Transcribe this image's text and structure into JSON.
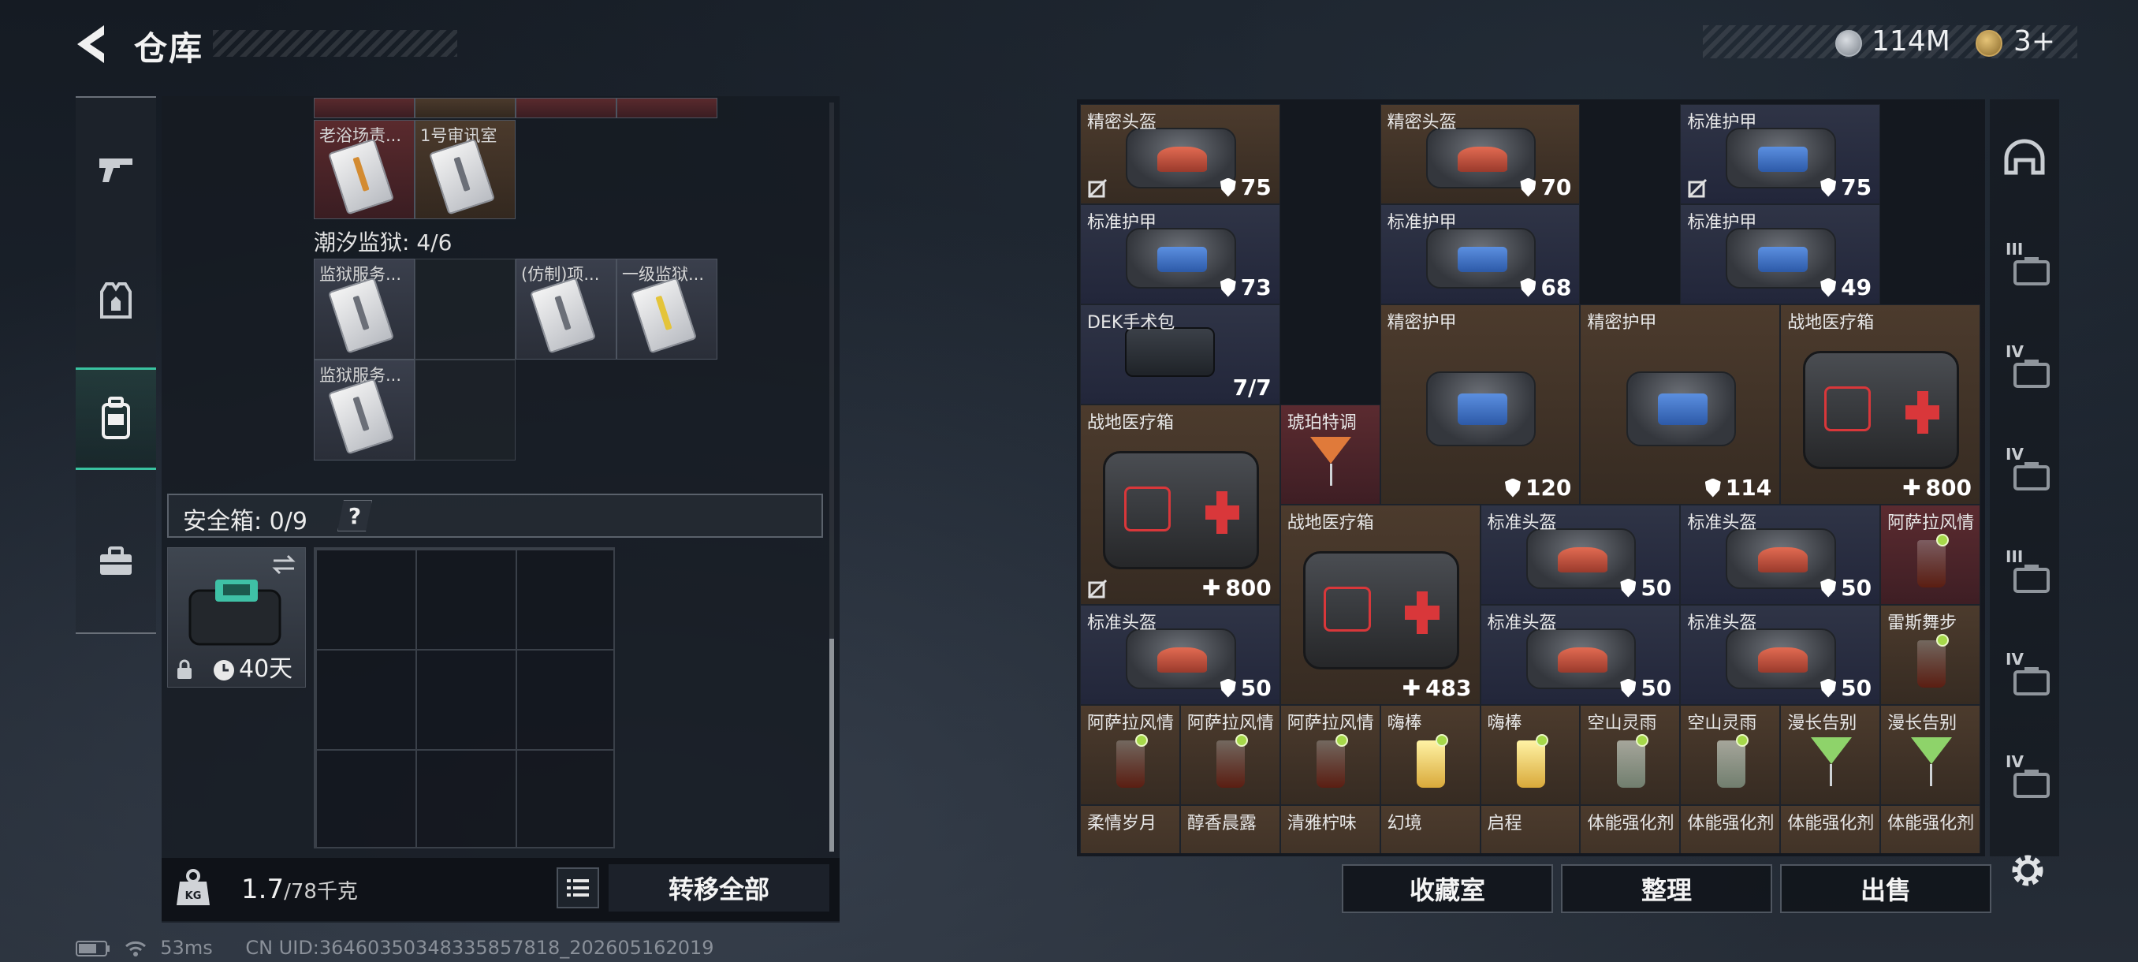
{
  "header": {
    "title": "仓库",
    "currency_1": "114M",
    "currency_2": "3+"
  },
  "left": {
    "top_items": [
      {
        "label": "老浴场责...",
        "color": "red"
      },
      {
        "label": "1号审讯室",
        "color": "brown"
      }
    ],
    "section_label": "潮汐监狱: 4/6",
    "section_items": [
      {
        "label": "监狱服务...",
        "color": "gray"
      },
      {
        "label": "(仿制)项...",
        "color": "gray"
      },
      {
        "label": "一级监狱...",
        "color": "gray"
      },
      {
        "label": "监狱服务...",
        "color": "gray"
      }
    ],
    "safe_label": "安全箱: 0/9",
    "safe_help": "?",
    "safe_item_time": "40天",
    "weight_current": "1.7",
    "weight_max": "/78千克",
    "transfer_label": "转移全部"
  },
  "status": {
    "ping": "53ms",
    "uid": "CN UID:3646035034833585​7818_202605162019"
  },
  "grid_items": [
    {
      "name": "精密头盔",
      "value": "75",
      "kind": "helm",
      "bg": "brown",
      "nodrop": true
    },
    {
      "name": "精密头盔",
      "value": "70",
      "kind": "helm",
      "bg": "brown",
      "nodrop": false
    },
    {
      "name": "标准护甲",
      "value": "75",
      "kind": "armor",
      "bg": "navy",
      "nodrop": true
    },
    {
      "name": "标准护甲",
      "value": "73",
      "kind": "armor",
      "bg": "navy",
      "nodrop": false
    },
    {
      "name": "标准护甲",
      "value": "68",
      "kind": "armor",
      "bg": "navy",
      "nodrop": false
    },
    {
      "name": "标准护甲",
      "value": "49",
      "kind": "armor",
      "bg": "navy",
      "nodrop": false
    },
    {
      "name": "DEK手术包",
      "value": "7/7",
      "kind": "pouch",
      "bg": "navy",
      "nodrop": false
    },
    {
      "name": "精密护甲",
      "value": "120",
      "kind": "armor",
      "bg": "brown",
      "nodrop": false
    },
    {
      "name": "精密护甲",
      "value": "114",
      "kind": "armor",
      "bg": "brown",
      "nodrop": false
    },
    {
      "name": "战地医疗箱",
      "value": "800",
      "kind": "medkit",
      "bg": "brown",
      "nodrop": false
    },
    {
      "name": "战地医疗箱",
      "value": "800",
      "kind": "medkit",
      "bg": "brown",
      "nodrop": true
    },
    {
      "name": "琥珀特调",
      "value": "",
      "kind": "cocktail-orange",
      "bg": "red",
      "nodrop": false
    },
    {
      "name": "战地医疗箱",
      "value": "483",
      "kind": "medkit",
      "bg": "brown",
      "nodrop": false
    },
    {
      "name": "标准头盔",
      "value": "50",
      "kind": "helm",
      "bg": "navy",
      "nodrop": false
    },
    {
      "name": "标准头盔",
      "value": "50",
      "kind": "helm",
      "bg": "navy",
      "nodrop": false
    },
    {
      "name": "阿萨拉风情",
      "value": "",
      "kind": "cola",
      "bg": "red",
      "nodrop": false
    },
    {
      "name": "标准头盔",
      "value": "50",
      "kind": "helm",
      "bg": "navy",
      "nodrop": false
    },
    {
      "name": "标准头盔",
      "value": "50",
      "kind": "helm",
      "bg": "navy",
      "nodrop": false
    },
    {
      "name": "标准头盔",
      "value": "50",
      "kind": "helm",
      "bg": "navy",
      "nodrop": false
    },
    {
      "name": "雷斯舞步",
      "value": "",
      "kind": "cola",
      "bg": "brown",
      "nodrop": false
    },
    {
      "name": "阿萨拉风情",
      "value": "",
      "kind": "cola",
      "bg": "brown",
      "nodrop": false
    },
    {
      "name": "阿萨拉风情",
      "value": "",
      "kind": "cola",
      "bg": "brown",
      "nodrop": false
    },
    {
      "name": "阿萨拉风情",
      "value": "",
      "kind": "cola",
      "bg": "brown",
      "nodrop": false
    },
    {
      "name": "嗨棒",
      "value": "",
      "kind": "yellow",
      "bg": "brown",
      "nodrop": false
    },
    {
      "name": "嗨棒",
      "value": "",
      "kind": "yellow",
      "bg": "brown",
      "nodrop": false
    },
    {
      "name": "空山灵雨",
      "value": "",
      "kind": "clear",
      "bg": "brown",
      "nodrop": false
    },
    {
      "name": "空山灵雨",
      "value": "",
      "kind": "clear",
      "bg": "brown",
      "nodrop": false
    },
    {
      "name": "漫长告别",
      "value": "",
      "kind": "cocktail",
      "bg": "brown",
      "nodrop": false
    },
    {
      "name": "漫长告别",
      "value": "",
      "kind": "cocktail",
      "bg": "brown",
      "nodrop": false
    },
    {
      "name": "柔情岁月",
      "value": "",
      "kind": "none",
      "bg": "brown",
      "nodrop": false
    },
    {
      "name": "醇香晨露",
      "value": "",
      "kind": "none",
      "bg": "brown",
      "nodrop": false
    },
    {
      "name": "清雅柠味",
      "value": "",
      "kind": "none",
      "bg": "brown",
      "nodrop": false
    },
    {
      "name": "幻境",
      "value": "",
      "kind": "none",
      "bg": "brown",
      "nodrop": false
    },
    {
      "name": "启程",
      "value": "",
      "kind": "none",
      "bg": "brown",
      "nodrop": false
    },
    {
      "name": "体能强化剂",
      "value": "",
      "kind": "none",
      "bg": "brown",
      "nodrop": false
    },
    {
      "name": "体能强化剂",
      "value": "",
      "kind": "none",
      "bg": "brown",
      "nodrop": false
    },
    {
      "name": "体能强化剂",
      "value": "",
      "kind": "none",
      "bg": "brown",
      "nodrop": false
    },
    {
      "name": "体能强化剂",
      "value": "",
      "kind": "none",
      "bg": "brown",
      "nodrop": false
    }
  ],
  "right_nav": [
    "III",
    "IV",
    "IV",
    "III",
    "IV",
    "IV"
  ],
  "actions": {
    "collection": "收藏室",
    "sort": "整理",
    "sell": "出售"
  }
}
